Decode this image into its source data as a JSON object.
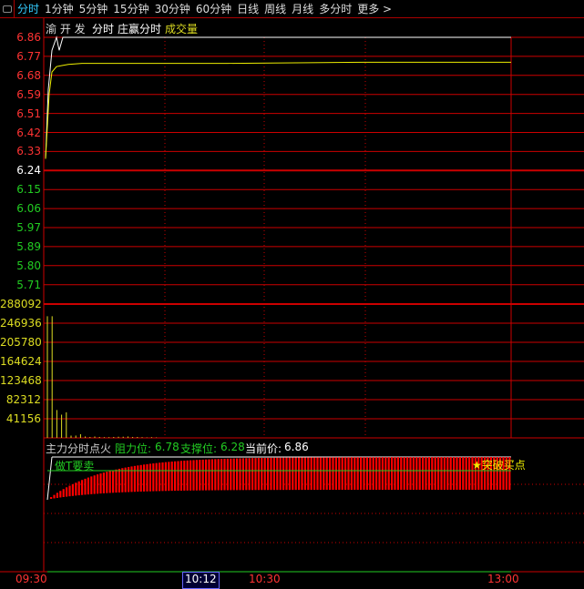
{
  "tabs": [
    "分时",
    "1分钟",
    "5分钟",
    "15分钟",
    "30分钟",
    "60分钟",
    "日线",
    "周线",
    "月线",
    "多分时",
    "更多 >"
  ],
  "header": {
    "stock": "渝 开 发",
    "mode": "分时",
    "indicator": "庄赢分时",
    "volume": "成交量"
  },
  "price_axis": [
    {
      "v": "6.86",
      "c": "#f33"
    },
    {
      "v": "6.77",
      "c": "#f33"
    },
    {
      "v": "6.68",
      "c": "#f33"
    },
    {
      "v": "6.59",
      "c": "#f33"
    },
    {
      "v": "6.51",
      "c": "#f33"
    },
    {
      "v": "6.42",
      "c": "#f33"
    },
    {
      "v": "6.33",
      "c": "#f33"
    },
    {
      "v": "6.24",
      "c": "#fff"
    },
    {
      "v": "6.15",
      "c": "#2c2"
    },
    {
      "v": "6.06",
      "c": "#2c2"
    },
    {
      "v": "5.97",
      "c": "#2c2"
    },
    {
      "v": "5.89",
      "c": "#2c2"
    },
    {
      "v": "5.80",
      "c": "#2c2"
    },
    {
      "v": "5.71",
      "c": "#2c2"
    }
  ],
  "volume_axis": [
    "288092",
    "246936",
    "205780",
    "164624",
    "123468",
    "82312",
    "41156"
  ],
  "indicator": {
    "name": "主力分时点火",
    "resist_label": "阻力位:",
    "resist": "6.78",
    "support_label": "支撑位:",
    "support": "6.28",
    "current_label": "当前价:",
    "current": "6.86",
    "sell_signal": "做T要卖",
    "buy_signal": "★突破买点"
  },
  "time_axis": {
    "start": "09:30",
    "cursor": "10:12",
    "mid": "10:30",
    "end": "13:00"
  },
  "price_series": [
    6.3,
    6.62,
    6.8,
    6.86,
    6.8,
    6.86,
    6.86,
    6.86
  ],
  "avg_series": [
    6.3,
    6.6,
    6.7,
    6.725,
    6.73,
    6.735,
    6.74,
    6.74,
    6.74,
    6.745,
    6.745
  ],
  "volume_series": [
    262000,
    262000,
    60000,
    50000,
    55000,
    5000,
    5000,
    8000,
    3000,
    2000,
    3000,
    2000,
    1500,
    1500,
    2000,
    2500,
    2500,
    3000,
    2000,
    2000,
    1500,
    1000,
    1500,
    1000
  ],
  "colors": {
    "up": "#f33",
    "down": "#2c2",
    "grid": "#c00",
    "vol": "#dd2",
    "price": "#fff",
    "avg": "#ee0"
  }
}
